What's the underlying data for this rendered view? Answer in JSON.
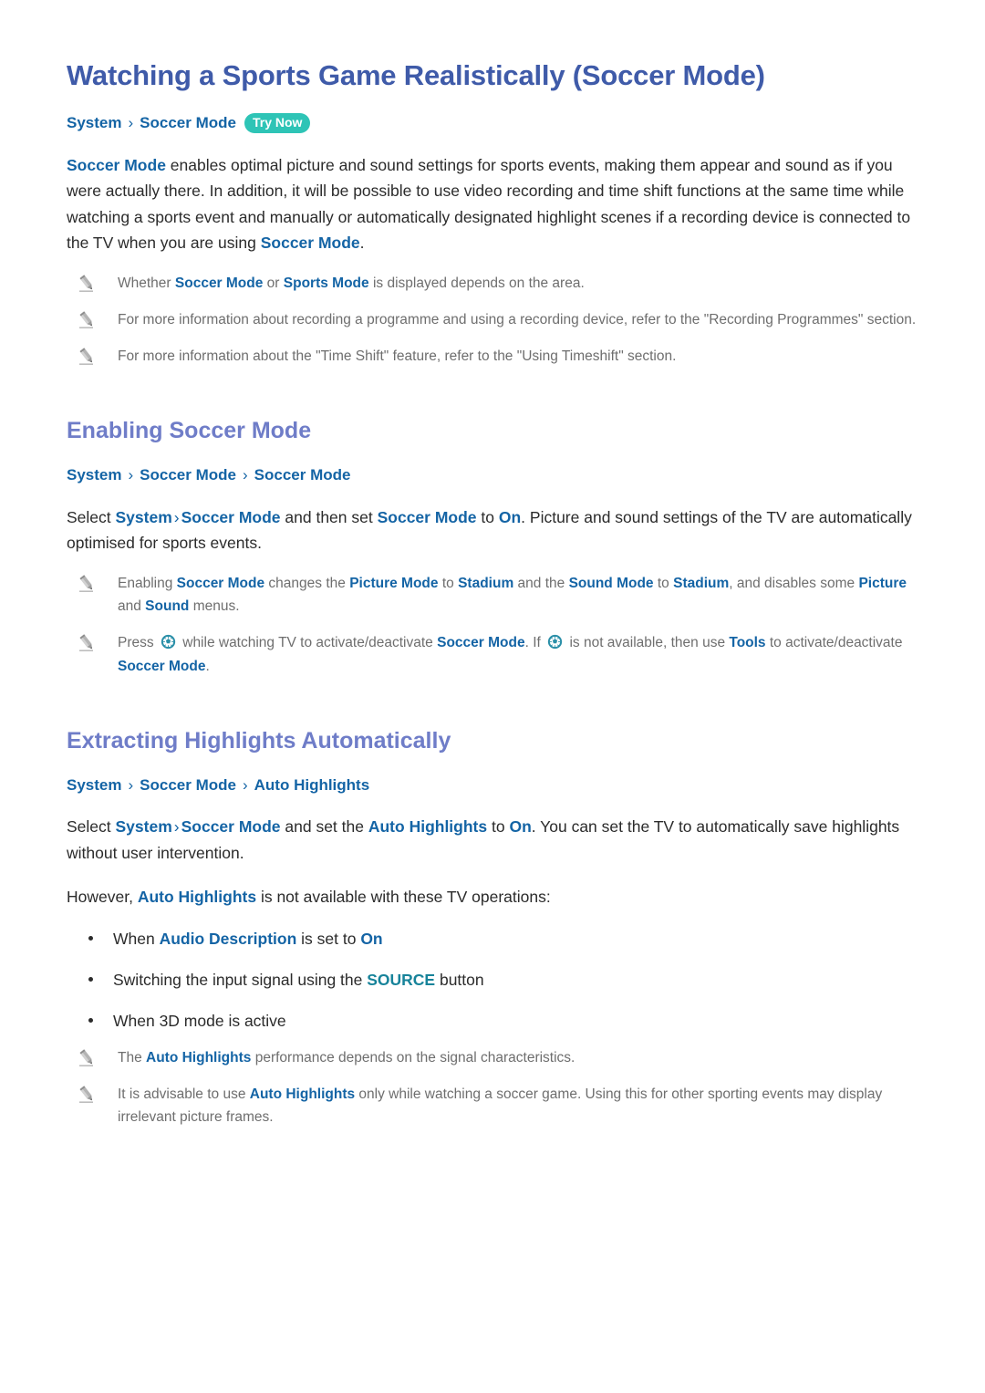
{
  "colors": {
    "title": "#3F5BA9",
    "section_heading": "#6F7DC8",
    "link": "#1464A5",
    "teal_link": "#17839A",
    "badge_bg": "#2EC4B6",
    "note_text": "#6E6E6E",
    "body_text": "#2B2B2B"
  },
  "title": "Watching a Sports Game Realistically (Soccer Mode)",
  "top_breadcrumb": {
    "crumbs": [
      "System",
      "Soccer Mode"
    ],
    "separator": "›",
    "badge": "Try Now"
  },
  "intro": {
    "lead_link": "Soccer Mode",
    "text_1": " enables optimal picture and sound settings for sports events, making them appear and sound as if you were actually there. In addition, it will be possible to use video recording and time shift functions at the same time while watching a sports event and manually or automatically designated highlight scenes if a recording device is connected to the TV when you are using ",
    "tail_link": "Soccer Mode",
    "text_2": "."
  },
  "intro_notes": [
    {
      "parts": [
        {
          "t": "Whether ",
          "s": "plain"
        },
        {
          "t": "Soccer Mode",
          "s": "link"
        },
        {
          "t": " or ",
          "s": "plain"
        },
        {
          "t": "Sports Mode",
          "s": "link"
        },
        {
          "t": " is displayed depends on the area.",
          "s": "plain"
        }
      ]
    },
    {
      "parts": [
        {
          "t": "For more information about recording a programme and using a recording device, refer to the \"Recording Programmes\" section.",
          "s": "plain"
        }
      ]
    },
    {
      "parts": [
        {
          "t": "For more information about the \"Time Shift\" feature, refer to the \"Using Timeshift\" section.",
          "s": "plain"
        }
      ]
    }
  ],
  "section_enabling": {
    "heading": "Enabling Soccer Mode",
    "breadcrumb": {
      "crumbs": [
        "System",
        "Soccer Mode",
        "Soccer Mode"
      ],
      "separator": "›"
    },
    "paragraph": [
      {
        "t": "Select ",
        "s": "plain"
      },
      {
        "t": "System",
        "s": "link"
      },
      {
        "t": "›",
        "s": "sep"
      },
      {
        "t": "Soccer Mode",
        "s": "link"
      },
      {
        "t": " and then set ",
        "s": "plain"
      },
      {
        "t": "Soccer Mode",
        "s": "link"
      },
      {
        "t": " to ",
        "s": "plain"
      },
      {
        "t": "On",
        "s": "link"
      },
      {
        "t": ". Picture and sound settings of the TV are automatically optimised for sports events.",
        "s": "plain"
      }
    ],
    "notes": [
      {
        "parts": [
          {
            "t": "Enabling ",
            "s": "plain"
          },
          {
            "t": "Soccer Mode",
            "s": "link"
          },
          {
            "t": " changes the ",
            "s": "plain"
          },
          {
            "t": "Picture Mode",
            "s": "link"
          },
          {
            "t": " to ",
            "s": "plain"
          },
          {
            "t": "Stadium",
            "s": "link"
          },
          {
            "t": " and the ",
            "s": "plain"
          },
          {
            "t": "Sound Mode",
            "s": "link"
          },
          {
            "t": " to ",
            "s": "plain"
          },
          {
            "t": "Stadium",
            "s": "link"
          },
          {
            "t": ", and disables some ",
            "s": "plain"
          },
          {
            "t": "Picture",
            "s": "link"
          },
          {
            "t": " and ",
            "s": "plain"
          },
          {
            "t": "Sound",
            "s": "link"
          },
          {
            "t": " menus.",
            "s": "plain"
          }
        ]
      },
      {
        "parts": [
          {
            "t": "Press ",
            "s": "plain"
          },
          {
            "t": "",
            "s": "ball"
          },
          {
            "t": " while watching TV to activate/deactivate ",
            "s": "plain"
          },
          {
            "t": "Soccer Mode",
            "s": "link"
          },
          {
            "t": ". If ",
            "s": "plain"
          },
          {
            "t": "",
            "s": "ball"
          },
          {
            "t": " is not available, then use ",
            "s": "plain"
          },
          {
            "t": "Tools",
            "s": "link"
          },
          {
            "t": " to activate/deactivate ",
            "s": "plain"
          },
          {
            "t": "Soccer Mode",
            "s": "link"
          },
          {
            "t": ".",
            "s": "plain"
          }
        ]
      }
    ]
  },
  "section_highlights": {
    "heading": "Extracting Highlights Automatically",
    "breadcrumb": {
      "crumbs": [
        "System",
        "Soccer Mode",
        "Auto Highlights"
      ],
      "separator": "›"
    },
    "paragraph": [
      {
        "t": "Select ",
        "s": "plain"
      },
      {
        "t": "System",
        "s": "link"
      },
      {
        "t": "›",
        "s": "sep"
      },
      {
        "t": "Soccer Mode",
        "s": "link"
      },
      {
        "t": " and set the ",
        "s": "plain"
      },
      {
        "t": "Auto Highlights",
        "s": "link"
      },
      {
        "t": " to ",
        "s": "plain"
      },
      {
        "t": "On",
        "s": "link"
      },
      {
        "t": ". You can set the TV to automatically save highlights without user intervention.",
        "s": "plain"
      }
    ],
    "paragraph_2": [
      {
        "t": "However, ",
        "s": "plain"
      },
      {
        "t": "Auto Highlights",
        "s": "link"
      },
      {
        "t": " is not available with these TV operations:",
        "s": "plain"
      }
    ],
    "bullets": [
      [
        {
          "t": "When ",
          "s": "plain"
        },
        {
          "t": "Audio Description",
          "s": "link"
        },
        {
          "t": " is set to ",
          "s": "plain"
        },
        {
          "t": "On",
          "s": "link"
        }
      ],
      [
        {
          "t": "Switching the input signal using the ",
          "s": "plain"
        },
        {
          "t": "SOURCE",
          "s": "teal"
        },
        {
          "t": " button",
          "s": "plain"
        }
      ],
      [
        {
          "t": "When 3D mode is active",
          "s": "plain"
        }
      ]
    ],
    "notes": [
      {
        "parts": [
          {
            "t": "The ",
            "s": "plain"
          },
          {
            "t": "Auto Highlights",
            "s": "link"
          },
          {
            "t": " performance depends on the signal characteristics.",
            "s": "plain"
          }
        ]
      },
      {
        "parts": [
          {
            "t": "It is advisable to use ",
            "s": "plain"
          },
          {
            "t": "Auto Highlights",
            "s": "link"
          },
          {
            "t": " only while watching a soccer game. Using this for other sporting events may display irrelevant picture frames.",
            "s": "plain"
          }
        ]
      }
    ]
  }
}
